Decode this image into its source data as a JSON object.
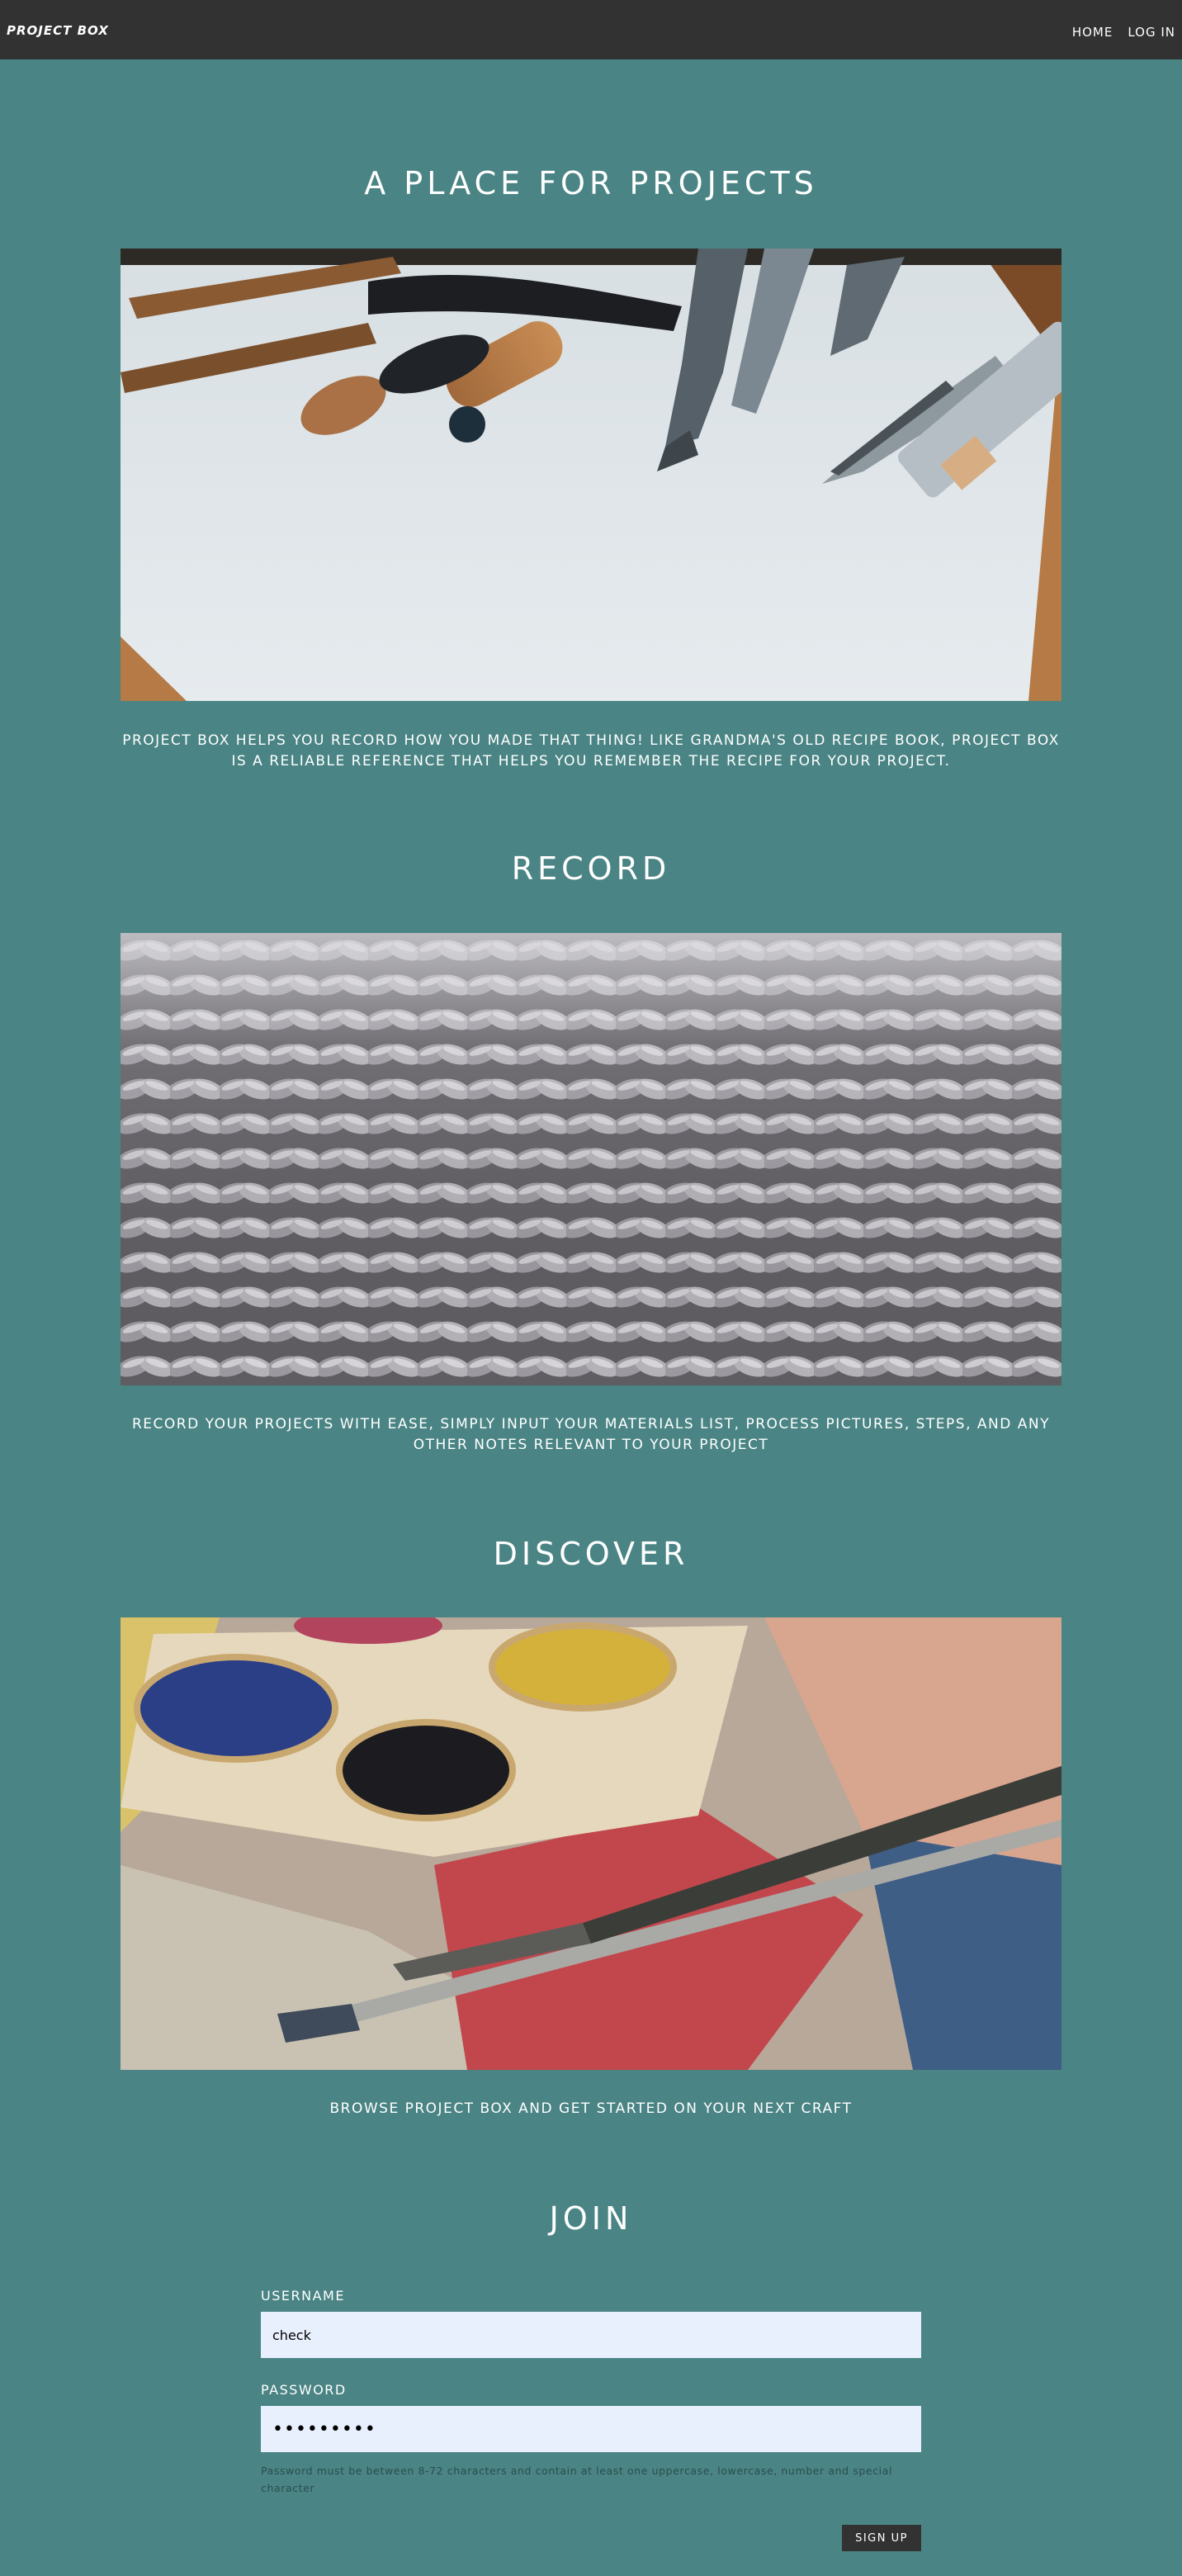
{
  "nav": {
    "brand": "PROJECT BOX",
    "links": [
      "HOME",
      "LOG IN"
    ]
  },
  "sections": [
    {
      "title": "A PLACE FOR PROJECTS",
      "caption": "PROJECT BOX HELPS YOU RECORD HOW YOU MADE THAT THING! LIKE GRANDMA'S OLD RECIPE BOOK, PROJECT BOX IS A RELIABLE REFERENCE THAT HELPS YOU REMEMBER THE RECIPE FOR YOUR PROJECT."
    },
    {
      "title": "RECORD",
      "caption": "RECORD YOUR PROJECTS WITH EASE, SIMPLY INPUT YOUR MATERIALS LIST, PROCESS PICTURES, STEPS, AND ANY OTHER NOTES RELEVANT TO YOUR PROJECT"
    },
    {
      "title": "DISCOVER",
      "caption": "BROWSE PROJECT BOX AND GET STARTED ON YOUR NEXT CRAFT"
    }
  ],
  "join": {
    "title": "JOIN",
    "username_label": "USERNAME",
    "username_value": "check",
    "password_label": "PASSWORD",
    "password_value": "•••••••••",
    "hint": "Password must be between 8-72 characters and contain at least one uppercase, lowercase, number and special character",
    "submit_label": "SIGN UP"
  }
}
